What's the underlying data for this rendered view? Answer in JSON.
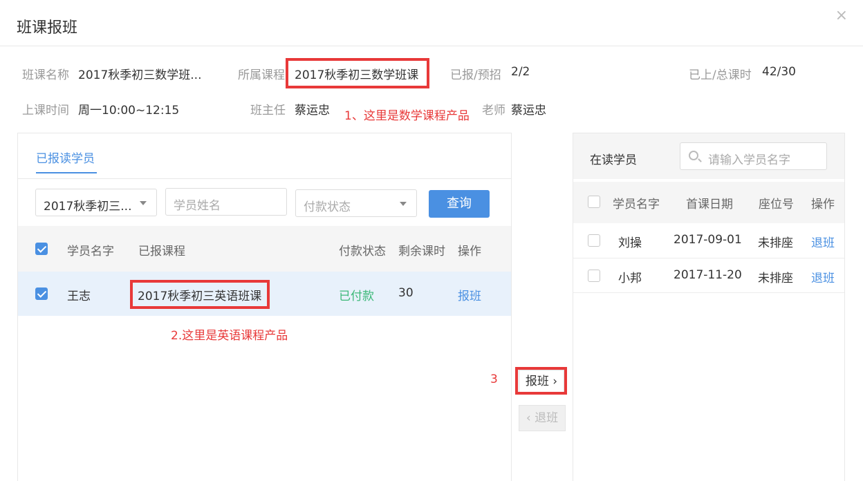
{
  "dialog": {
    "title": "班课报班",
    "close_glyph": "×"
  },
  "info": {
    "class_name_label": "班课名称",
    "class_name_value": "2017秋季初三数学班...",
    "course_label": "所属课程",
    "course_value": "2017秋季初三数学班课",
    "enrolled_label": "已报/预招",
    "enrolled_value": "2/2",
    "lessons_label": "已上/总课时",
    "lessons_value": "42/30",
    "time_label": "上课时间",
    "time_value": "周一10:00~12:15",
    "head_teacher_label": "班主任",
    "head_teacher_value": "蔡运忠",
    "teacher_label": "老师",
    "teacher_value": "蔡运忠"
  },
  "annotations": {
    "note1": "1、这里是数学课程产品",
    "note2": "2.这里是英语课程产品",
    "note3": "3"
  },
  "left_panel": {
    "tab_label": "已报读学员",
    "filters": {
      "course_select_value": "2017秋季初三...",
      "name_placeholder": "学员姓名",
      "payment_status_placeholder": "付款状态",
      "search_button": "查询"
    },
    "columns": [
      "学员名字",
      "已报课程",
      "付款状态",
      "剩余课时",
      "操作"
    ],
    "rows": [
      {
        "name": "王志",
        "course": "2017秋季初三英语班课",
        "payment": "已付款",
        "remaining": "30",
        "action": "报班",
        "checked": true
      }
    ]
  },
  "transfer": {
    "enroll_label": "报班 ›",
    "withdraw_label": "‹ 退班"
  },
  "right_panel": {
    "title": "在读学员",
    "search_placeholder": "请输入学员名字",
    "columns": [
      "学员名字",
      "首课日期",
      "座位号",
      "操作"
    ],
    "rows": [
      {
        "name": "刘操",
        "first_date": "2017-09-01",
        "seat": "未排座",
        "action": "退班"
      },
      {
        "name": "小邦",
        "first_date": "2017-11-20",
        "seat": "未排座",
        "action": "退班"
      }
    ]
  },
  "colors": {
    "accent": "#4a90e2",
    "annotation_red": "#e83939",
    "paid_green": "#3cb878"
  }
}
